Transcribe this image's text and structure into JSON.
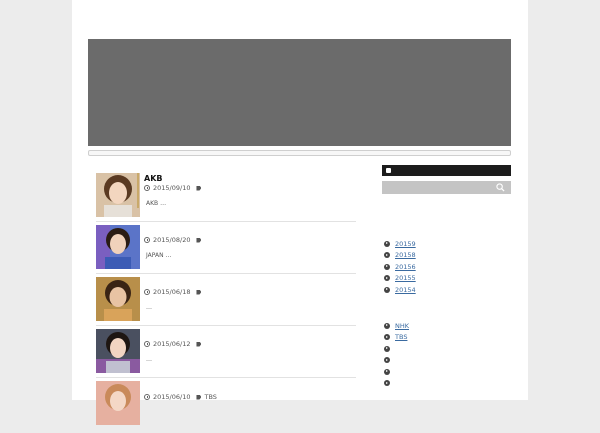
{
  "posts": [
    {
      "title": "AKB",
      "date": "2015/09/10",
      "tag": "",
      "excerpt": "AKB …"
    },
    {
      "title": "",
      "date": "2015/08/20",
      "tag": "",
      "excerpt": "JAPAN …"
    },
    {
      "title": "",
      "date": "2015/06/18",
      "tag": "",
      "excerpt": "…"
    },
    {
      "title": "",
      "date": "2015/06/12",
      "tag": "",
      "excerpt": "…"
    },
    {
      "title": "",
      "date": "2015/06/10",
      "tag": "TBS",
      "excerpt": ""
    }
  ],
  "archives": [
    "20159",
    "20158",
    "20156",
    "20155",
    "20154"
  ],
  "categories": [
    "NHK",
    "TBS",
    "",
    "",
    "",
    ""
  ],
  "colors": {
    "hero": "#6b6b6b",
    "rss_bar": "#1c1c1c",
    "search_bar": "#c4c4c4",
    "link": "#3a6aa0"
  }
}
